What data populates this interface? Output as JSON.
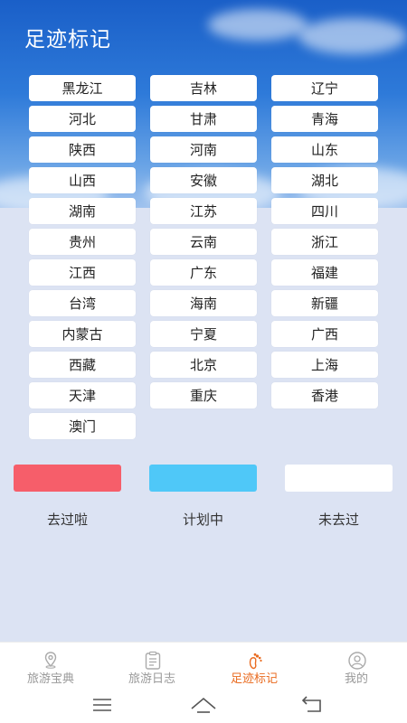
{
  "page": {
    "title": "足迹标记"
  },
  "provinces": [
    "黑龙江",
    "吉林",
    "辽宁",
    "河北",
    "甘肃",
    "青海",
    "陕西",
    "河南",
    "山东",
    "山西",
    "安徽",
    "湖北",
    "湖南",
    "江苏",
    "四川",
    "贵州",
    "云南",
    "浙江",
    "江西",
    "广东",
    "福建",
    "台湾",
    "海南",
    "新疆",
    "内蒙古",
    "宁夏",
    "广西",
    "西藏",
    "北京",
    "上海",
    "天津",
    "重庆",
    "香港",
    "澳门"
  ],
  "legend": [
    {
      "label": "去过啦",
      "color": "#f65e6a"
    },
    {
      "label": "计划中",
      "color": "#4fc8f8"
    },
    {
      "label": "未去过",
      "color": "#ffffff"
    }
  ],
  "tabs": [
    {
      "label": "旅游宝典",
      "icon": "location-pin-icon",
      "active": false
    },
    {
      "label": "旅游日志",
      "icon": "clipboard-icon",
      "active": false
    },
    {
      "label": "足迹标记",
      "icon": "footprint-icon",
      "active": true
    },
    {
      "label": "我的",
      "icon": "user-icon",
      "active": false
    }
  ],
  "colors": {
    "active_tab": "#e96b20",
    "inactive_tab": "#999999",
    "page_background": "#dce3f3"
  }
}
